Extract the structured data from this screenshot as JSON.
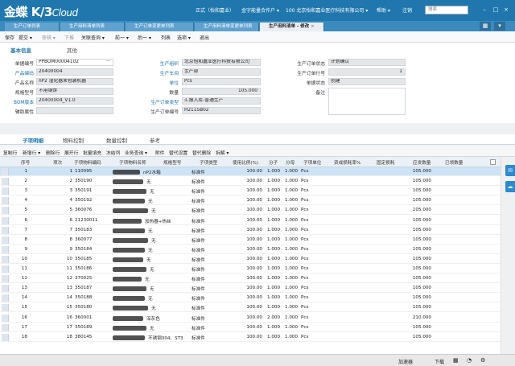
{
  "app": {
    "logo_main": "金蝶",
    "logo_k3": "K/3",
    "logo_cloud": "Cloud"
  },
  "topnav": {
    "item1": "正式（怡和嘉业）",
    "item2": "金字能量合作户 ▾",
    "item3": "100 北京怡和嘉业医疗科技有限公司 ▾",
    "help": "帮助 ▾",
    "logout": "注销",
    "search_placeholder": "搜索"
  },
  "tabs": [
    {
      "label": "生产订单列表"
    },
    {
      "label": "生产用料清单列表"
    },
    {
      "label": "生产订单变更单列表"
    },
    {
      "label": "生产用料清单变更单列表"
    },
    {
      "label": "生产用料清单 - 修改"
    }
  ],
  "toolbar": [
    "保存",
    "提交 ▾",
    "审核 ▾",
    "下推",
    "关联查询 ▾",
    "前一 ▾",
    "后一 ▾",
    "列表",
    "选项 ▾",
    "退出"
  ],
  "subtabs": {
    "basic": "基本信息",
    "other": "其他"
  },
  "form": {
    "bill_no_label": "单据编号",
    "bill_no": "PPBOM00004102",
    "product_code_label": "产品编码",
    "product_code": "20400004",
    "product_name_label": "产品名称",
    "product_name": "nP2 湿化器末包装机器",
    "spec_label": "规格型号",
    "spec": "不用钢饼",
    "bom_label": "BOM版本",
    "bom": "20400004_V1.0",
    "aux_label": "辅助属性",
    "aux": "",
    "org_label": "生产组织",
    "org": "北京怡和嘉业医疗科技有限公司",
    "workshop_label": "生产车间",
    "workshop": "生产部",
    "unit_label": "单位",
    "unit": "Pcs",
    "qty_label": "数量",
    "qty": "105.000",
    "ordertype_label": "生产订单类型",
    "ordertype": "汇报入库-普通生产",
    "orderno_label": "生产订单编号",
    "orderno": "H2115B02",
    "status_label": "生产订单状态",
    "status": "计划确认",
    "rowno_label": "生产订单行号",
    "rowno": "1",
    "docstatus_label": "单据状态",
    "docstatus": "创建",
    "note_label": "备注",
    "note": ""
  },
  "gridtabs": [
    "子项明细",
    "物料控制",
    "数量控制",
    "参考"
  ],
  "gridtools": [
    "复制行",
    "新增行 ▾",
    "删除行",
    "展开行",
    "批量填充",
    "冻结列",
    "业务查询 ▾",
    "附件",
    "替代设置",
    "替代删除",
    "拆解 ▾"
  ],
  "grid_headers": [
    "序号",
    "项次",
    "子项物料编码",
    "子项物料名称",
    "规格型号",
    "子项类型",
    "使用比例(%)",
    "分子",
    "分母",
    "子项单位",
    "资成损耗率%",
    "固定损耗",
    "应发数量",
    "已领数量"
  ],
  "rows": [
    {
      "seq": "1",
      "item": "1",
      "code": "110095",
      "name": "",
      "name_tail": "nP2水箱",
      "spec": "",
      "type": "标准件",
      "ratio": "100.00",
      "num": "1.000",
      "den": "1.000",
      "unit": "Pcs",
      "qty": "105.000",
      "blur": [
        34,
        3
      ]
    },
    {
      "seq": "2",
      "item": "2",
      "code": "350190",
      "name": "",
      "name_tail": "无",
      "spec": "",
      "type": "标准件",
      "ratio": "100.00",
      "num": "1.000",
      "den": "1.000",
      "unit": "Pcs",
      "qty": "105.000",
      "blur": [
        38,
        0
      ]
    },
    {
      "seq": "3",
      "item": "3",
      "code": "350191",
      "name": "",
      "name_tail": "无",
      "spec": "",
      "type": "标准件",
      "ratio": "100.00",
      "num": "1.000",
      "den": "1.000",
      "unit": "Pcs",
      "qty": "105.000",
      "blur": [
        42,
        0
      ]
    },
    {
      "seq": "4",
      "item": "4",
      "code": "350192",
      "name": "",
      "name_tail": "无",
      "spec": "",
      "type": "标准件",
      "ratio": "100.00",
      "num": "1.000",
      "den": "1.000",
      "unit": "Pcs",
      "qty": "105.000",
      "blur": [
        40,
        0
      ]
    },
    {
      "seq": "5",
      "item": "5",
      "code": "360076",
      "name": "",
      "name_tail": "无",
      "spec": "",
      "type": "标准件",
      "ratio": "100.00",
      "num": "1.000",
      "den": "1.000",
      "unit": "Pcs",
      "qty": "105.000",
      "blur": [
        44,
        0
      ]
    },
    {
      "seq": "6",
      "item": "6",
      "code": "21230011",
      "name": "",
      "name_tail": "加热器+热丝",
      "spec": "",
      "type": "标准件",
      "ratio": "100.00",
      "num": "1.000",
      "den": "1.000",
      "unit": "Pcs",
      "qty": "105.000",
      "blur": [
        36,
        2
      ]
    },
    {
      "seq": "7",
      "item": "7",
      "code": "350183",
      "name": "",
      "name_tail": "无",
      "spec": "",
      "type": "标准件",
      "ratio": "100.00",
      "num": "1.000",
      "den": "1.000",
      "unit": "Pcs",
      "qty": "105.000",
      "blur": [
        40,
        0
      ]
    },
    {
      "seq": "8",
      "item": "8",
      "code": "360077",
      "name": "",
      "name_tail": "无",
      "spec": "",
      "type": "标准件",
      "ratio": "100.00",
      "num": "1.000",
      "den": "1.000",
      "unit": "Pcs",
      "qty": "105.000",
      "blur": [
        44,
        0
      ]
    },
    {
      "seq": "9",
      "item": "9",
      "code": "350184",
      "name": "",
      "name_tail": "无",
      "spec": "",
      "type": "标准件",
      "ratio": "100.00",
      "num": "1.000",
      "den": "1.000",
      "unit": "Pcs",
      "qty": "105.000",
      "blur": [
        40,
        0
      ]
    },
    {
      "seq": "10",
      "item": "10",
      "code": "350185",
      "name": "",
      "name_tail": "无",
      "spec": "",
      "type": "标准件",
      "ratio": "100.00",
      "num": "1.000",
      "den": "1.000",
      "unit": "Pcs",
      "qty": "105.000",
      "blur": [
        38,
        0
      ]
    },
    {
      "seq": "11",
      "item": "11",
      "code": "350186",
      "name": "",
      "name_tail": "无",
      "spec": "",
      "type": "标准件",
      "ratio": "100.00",
      "num": "1.000",
      "den": "1.000",
      "unit": "Pcs",
      "qty": "105.000",
      "blur": [
        42,
        0
      ]
    },
    {
      "seq": "12",
      "item": "12",
      "code": "370025",
      "name": "",
      "name_tail": "无",
      "spec": "",
      "type": "标准件",
      "ratio": "100.00",
      "num": "1.000",
      "den": "1.000",
      "unit": "Pcs",
      "qty": "105.000",
      "blur": [
        36,
        0
      ]
    },
    {
      "seq": "13",
      "item": "13",
      "code": "350187",
      "name": "",
      "name_tail": "无",
      "spec": "",
      "type": "标准件",
      "ratio": "100.00",
      "num": "1.000",
      "den": "1.000",
      "unit": "Pcs",
      "qty": "105.000",
      "blur": [
        42,
        0
      ]
    },
    {
      "seq": "14",
      "item": "14",
      "code": "350188",
      "name": "",
      "name_tail": "无",
      "spec": "",
      "type": "标准件",
      "ratio": "100.00",
      "num": "1.000",
      "den": "1.000",
      "unit": "Pcs",
      "qty": "105.000",
      "blur": [
        40,
        0
      ]
    },
    {
      "seq": "15",
      "item": "15",
      "code": "350180",
      "name": "",
      "name_tail": "无",
      "spec": "",
      "type": "标准件",
      "ratio": "100.00",
      "num": "1.000",
      "den": "1.000",
      "unit": "Pcs",
      "qty": "105.000",
      "blur": [
        44,
        0
      ]
    },
    {
      "seq": "16",
      "item": "16",
      "code": "360001",
      "name": "",
      "name_tail": "深灰色",
      "spec": "",
      "type": "标准件",
      "ratio": "100.00",
      "num": "2.000",
      "den": "1.000",
      "unit": "Pcs",
      "qty": "210.000",
      "blur": [
        38,
        0
      ]
    },
    {
      "seq": "17",
      "item": "17",
      "code": "350189",
      "name": "",
      "name_tail": "无",
      "spec": "",
      "type": "标准件",
      "ratio": "100.00",
      "num": "1.000",
      "den": "1.000",
      "unit": "Pcs",
      "qty": "105.000",
      "blur": [
        42,
        0
      ]
    },
    {
      "seq": "18",
      "item": "18",
      "code": "380145",
      "name": "",
      "name_tail": "不锈钢304、ST3",
      "spec": "",
      "type": "标准件",
      "ratio": "100.00",
      "num": "1.000",
      "den": "1.000",
      "unit": "Pcs",
      "qty": "105.000",
      "blur": [
        40,
        0
      ]
    }
  ],
  "status": {
    "download": "加速器",
    "download2": "下载"
  }
}
